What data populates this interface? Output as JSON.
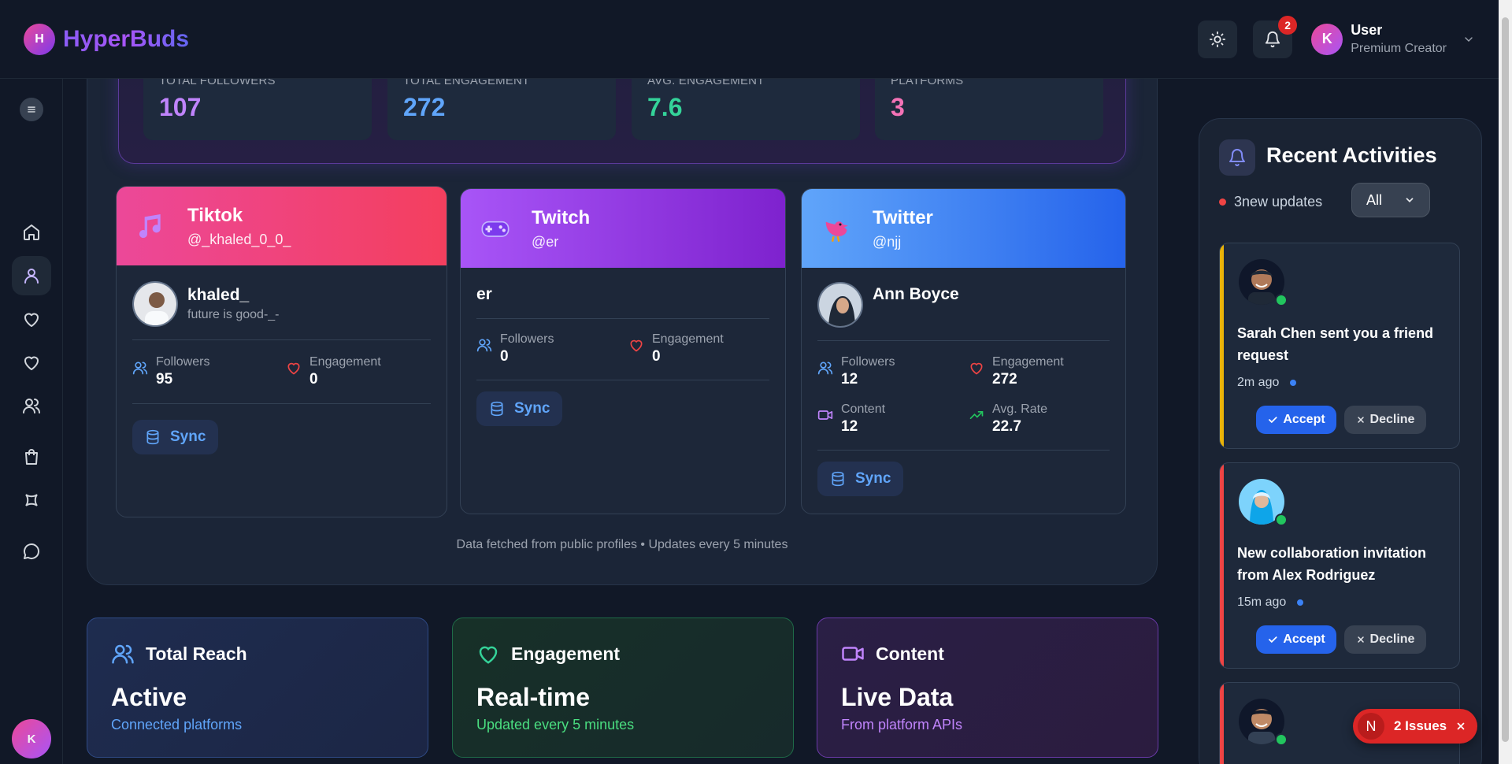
{
  "app": {
    "logo_letter": "H",
    "brand": "HyperBuds"
  },
  "header": {
    "notification_count": "2",
    "user": {
      "initial": "K",
      "name": "User",
      "role": "Premium Creator"
    }
  },
  "sidebar": {
    "items": [
      {
        "icon": "home-icon"
      },
      {
        "icon": "user-icon",
        "active": true
      },
      {
        "icon": "heart-icon"
      },
      {
        "icon": "heart-icon"
      },
      {
        "icon": "users-icon"
      },
      {
        "icon": "shopping-bag-icon"
      },
      {
        "icon": "shape-icon"
      },
      {
        "icon": "message-icon"
      }
    ],
    "avatar_initial": "K"
  },
  "stats": [
    {
      "label": "Total Followers",
      "value": "107",
      "color": "#c084fc"
    },
    {
      "label": "Total Engagement",
      "value": "272",
      "color": "#60a5fa"
    },
    {
      "label": "Avg. Engagement",
      "value": "7.6",
      "color": "#34d399"
    },
    {
      "label": "Platforms",
      "value": "3",
      "color": "#f472b6"
    }
  ],
  "platforms": [
    {
      "name": "Tiktok",
      "handle": "@_khaled_0_0_",
      "profile_name": "khaled_",
      "bio": "future is good-_-",
      "followers_label": "Followers",
      "followers": "95",
      "engagement_label": "Engagement",
      "engagement": "0",
      "sync_label": "Sync"
    },
    {
      "name": "Twitch",
      "handle": "@er",
      "profile_name": "er",
      "followers_label": "Followers",
      "followers": "0",
      "engagement_label": "Engagement",
      "engagement": "0",
      "sync_label": "Sync"
    },
    {
      "name": "Twitter",
      "handle": "@njj",
      "profile_name": "Ann Boyce",
      "followers_label": "Followers",
      "followers": "12",
      "engagement_label": "Engagement",
      "engagement": "272",
      "content_label": "Content",
      "content": "12",
      "rate_label": "Avg. Rate",
      "rate": "22.7",
      "sync_label": "Sync"
    }
  ],
  "footnote": "Data fetched from public profiles • Updates every 5 minutes",
  "info_cards": [
    {
      "title": "Total Reach",
      "big": "Active",
      "sub": "Connected platforms"
    },
    {
      "title": "Engagement",
      "big": "Real-time",
      "sub": "Updated every 5 minutes"
    },
    {
      "title": "Content",
      "big": "Live Data",
      "sub": "From platform APIs"
    }
  ],
  "activities_panel": {
    "title": "Recent Activities",
    "updates": "3new updates",
    "filter_value": "All",
    "items": [
      {
        "text": "Sarah Chen sent you a friend request",
        "time": "2m ago",
        "accept": "Accept",
        "decline": "Decline",
        "bar_color": "#eab308"
      },
      {
        "text": "New collaboration invitation from Alex Rodriguez",
        "time": "15m ago",
        "accept": "Accept",
        "decline": "Decline",
        "bar_color": "#ef4444"
      }
    ]
  },
  "issues": {
    "letter": "N",
    "text": "2 Issues"
  }
}
